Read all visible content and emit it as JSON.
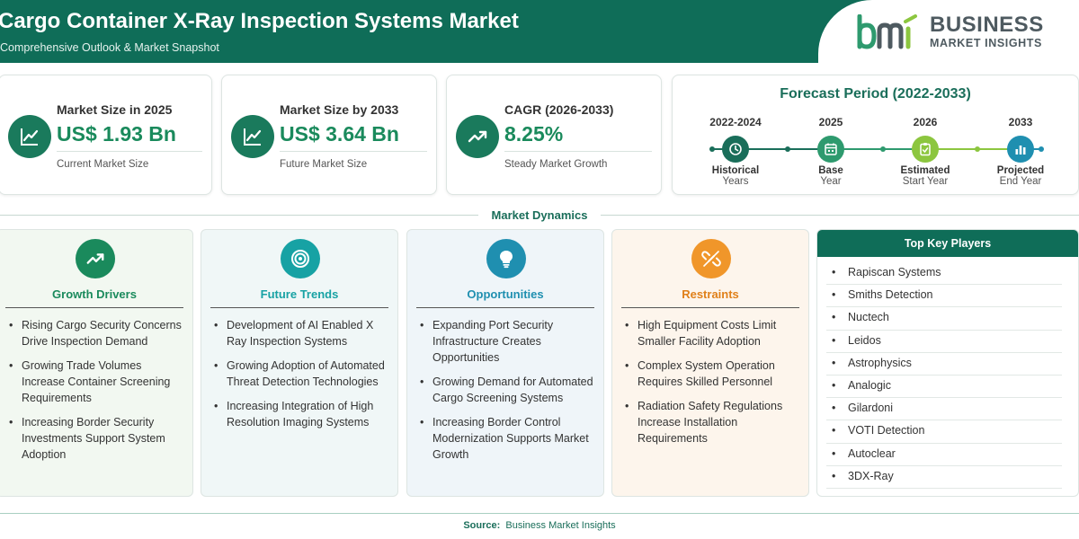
{
  "header": {
    "title": "Cargo Container X-Ray Inspection Systems Market",
    "subtitle": "Comprehensive Outlook & Market Snapshot",
    "logo_line1": "BUSINESS",
    "logo_line2": "MARKET INSIGHTS",
    "logo_mark": "bmi"
  },
  "stats": [
    {
      "label": "Market Size in 2025",
      "value": "US$ 1.93 Bn",
      "caption": "Current Market Size",
      "icon": "line-chart-icon"
    },
    {
      "label": "Market Size by 2033",
      "value": "US$ 3.64 Bn",
      "caption": "Future Market Size",
      "icon": "line-chart-icon"
    },
    {
      "label": "CAGR (2026-2033)",
      "value": "8.25%",
      "caption": "Steady Market Growth",
      "icon": "trend-up-icon"
    }
  ],
  "forecast": {
    "title": "Forecast Period (2022-2033)",
    "stages": [
      {
        "year": "2022-2024",
        "name": "Historical",
        "desc": "Years",
        "color": "#1a6e5a",
        "icon": "history-icon"
      },
      {
        "year": "2025",
        "name": "Base",
        "desc": "Year",
        "color": "#2e9a6e",
        "icon": "calendar-icon"
      },
      {
        "year": "2026",
        "name": "Estimated",
        "desc": "Start Year",
        "color": "#8cc63f",
        "icon": "clipboard-icon"
      },
      {
        "year": "2033",
        "name": "Projected",
        "desc": "End Year",
        "color": "#1f8fb0",
        "icon": "bar-chart-icon"
      }
    ]
  },
  "dynamics": {
    "title": "Market Dynamics",
    "cards": [
      {
        "title": "Growth Drivers",
        "color": "#1a8a5c",
        "icon": "trend-up-icon",
        "items": [
          "Rising Cargo Security Concerns Drive Inspection Demand",
          "Growing Trade Volumes Increase Container Screening Requirements",
          "Increasing Border Security Investments Support System Adoption"
        ]
      },
      {
        "title": "Future Trends",
        "color": "#17a2a4",
        "icon": "target-icon",
        "items": [
          "Development of AI Enabled X Ray Inspection Systems",
          "Growing Adoption of Automated Threat Detection Technologies",
          "Increasing Integration of High Resolution Imaging Systems"
        ]
      },
      {
        "title": "Opportunities",
        "color": "#1f8fb0",
        "icon": "lightbulb-icon",
        "items": [
          "Expanding Port Security Infrastructure Creates Opportunities",
          "Growing Demand for Automated Cargo Screening Systems",
          "Increasing Border Control Modernization Supports Market Growth"
        ]
      },
      {
        "title": "Restraints",
        "color": "#f0962a",
        "icon": "broken-link-icon",
        "items": [
          "High Equipment Costs Limit Smaller Facility Adoption",
          "Complex System Operation Requires Skilled Personnel",
          "Radiation Safety Regulations Increase Installation Requirements"
        ]
      }
    ]
  },
  "players": {
    "title": "Top Key Players",
    "items": [
      "Rapiscan Systems",
      "Smiths Detection",
      "Nuctech",
      "Leidos",
      "Astrophysics",
      "Analogic",
      "Gilardoni",
      "VOTI Detection",
      "Autoclear",
      "3DX-Ray"
    ]
  },
  "footer": {
    "label": "Source:",
    "text": "Business Market Insights"
  }
}
